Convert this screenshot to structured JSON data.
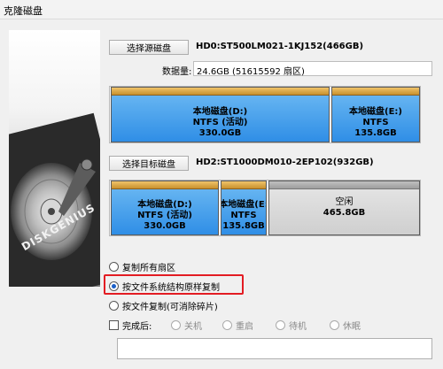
{
  "window": {
    "title": "克隆磁盘"
  },
  "art": {
    "brand": "DISKGENIUS"
  },
  "source": {
    "button_label": "选择源磁盘",
    "disk_name": "HD0:ST500LM021-1KJ152(466GB)",
    "data_amount_label": "数据量:",
    "data_amount_value": "24.6GB (51615592 扇区)",
    "partitions": [
      {
        "name": "本地磁盘(D:)",
        "fs": "NTFS (活动)",
        "size": "330.0GB"
      },
      {
        "name": "本地磁盘(E:)",
        "fs": "NTFS",
        "size": "135.8GB"
      }
    ]
  },
  "target": {
    "button_label": "选择目标磁盘",
    "disk_name": "HD2:ST1000DM010-2EP102(932GB)",
    "partitions": [
      {
        "name": "本地磁盘(D:)",
        "fs": "NTFS (活动)",
        "size": "330.0GB"
      },
      {
        "name": "本地磁盘(E:",
        "fs": "NTFS",
        "size": "135.8GB"
      },
      {
        "name": "空闲",
        "size": "465.8GB"
      }
    ]
  },
  "copy_modes": {
    "all_sectors": "复制所有扇区",
    "by_structure": "按文件系统结构原样复制",
    "by_file": "按文件复制(可消除碎片)",
    "selected": "by_structure"
  },
  "after_complete": {
    "label": "完成后:",
    "options": [
      "关机",
      "重启",
      "待机",
      "休眠"
    ],
    "selected": "关机"
  },
  "colors": {
    "partition_ntfs": "#2f8ee6",
    "partition_cap": "#c8902c",
    "highlight": "#e31c23"
  }
}
